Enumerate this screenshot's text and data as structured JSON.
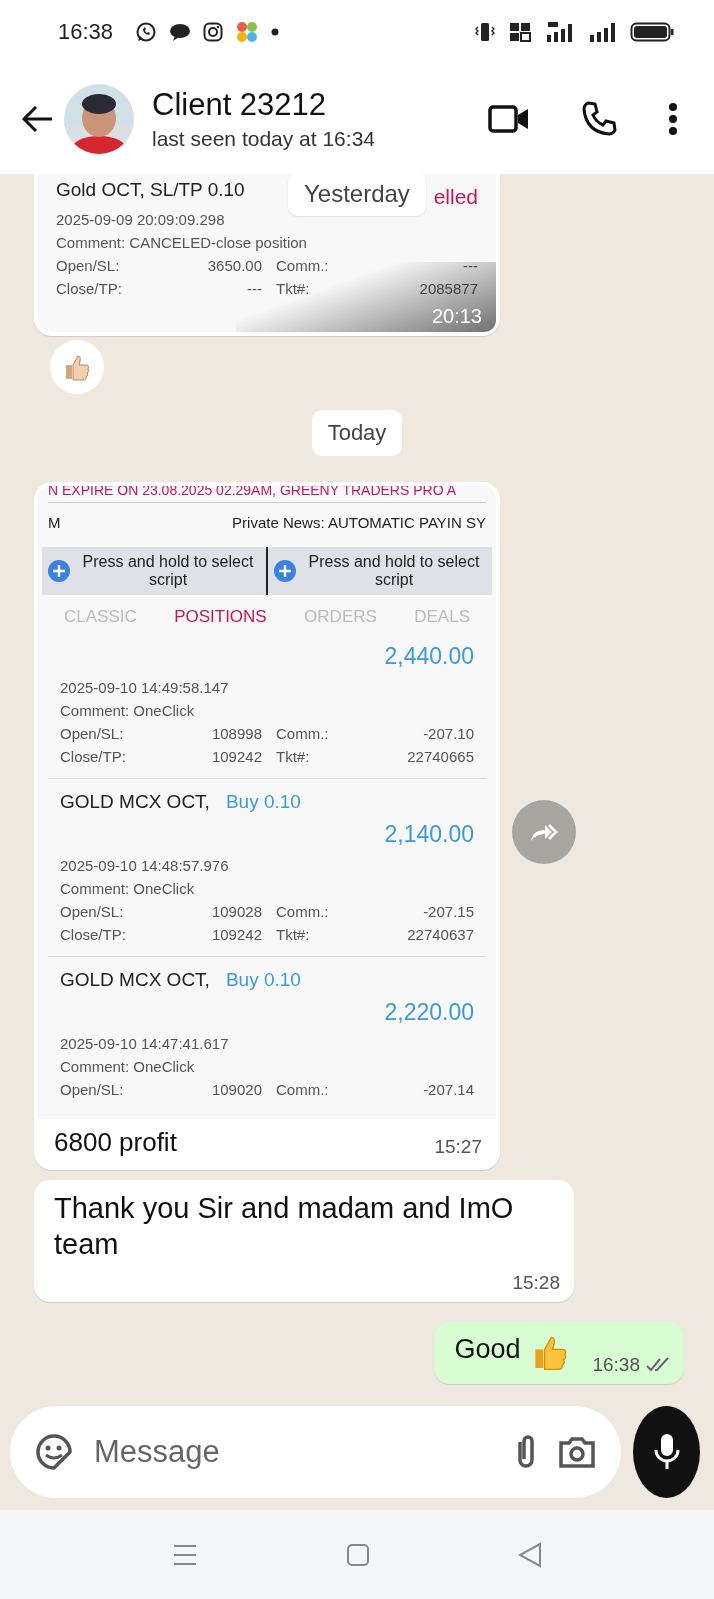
{
  "status_bar": {
    "time": "16:38"
  },
  "header": {
    "contact_name": "Client 23212",
    "last_seen": "last seen today at 16:34"
  },
  "messages": [
    {
      "kind": "trade_image",
      "date_overlay": "Yesterday",
      "time": "20:13",
      "reaction": true,
      "card": {
        "title": "Gold OCT,  SL/TP 0.10",
        "status": "elled",
        "datetime": "2025-09-09 20:09:09.298",
        "comment": "Comment: CANCELED-close position",
        "open_label": "Open/SL:",
        "open": "3650.00",
        "comm_label": "Comm.:",
        "comm": "---",
        "close_label": "Close/TP:",
        "close": "---",
        "ticket_label": "Tkt#:",
        "ticket": "2085877"
      }
    },
    {
      "kind": "date",
      "label": "Today"
    },
    {
      "kind": "terminal_image",
      "forward": true,
      "caption": "6800 profit",
      "time": "15:27",
      "terminal": {
        "ticker": "N  EXPIRE ON 23.08.2025 02.29AM, GREENY TRADERS PRO A",
        "news_left": "M",
        "news": "Private News:  AUTOMATIC PAYIN SY",
        "select_buttons": [
          "Press and hold to select script",
          "Press and hold to select script"
        ],
        "tabs": [
          {
            "label": "CLASSIC",
            "selected": false
          },
          {
            "label": "POSITIONS",
            "selected": true
          },
          {
            "label": "ORDERS",
            "selected": false
          },
          {
            "label": "DEALS",
            "selected": false
          }
        ],
        "positions": [
          {
            "profit": "2,440.00",
            "datetime": "2025-09-10 14:49:58.147",
            "comment": "Comment: OneClick",
            "rows": [
              [
                "Open/SL:",
                "108998",
                "Comm.:",
                "-207.10"
              ],
              [
                "Close/TP:",
                "109242",
                "Tkt#:",
                "22740665"
              ]
            ]
          },
          {
            "symbol": "GOLD MCX OCT,",
            "side": "Buy 0.10",
            "profit": "2,140.00",
            "datetime": "2025-09-10 14:48:57.976",
            "comment": "Comment: OneClick",
            "rows": [
              [
                "Open/SL:",
                "109028",
                "Comm.:",
                "-207.15"
              ],
              [
                "Close/TP:",
                "109242",
                "Tkt#:",
                "22740637"
              ]
            ]
          },
          {
            "symbol": "GOLD MCX OCT,",
            "side": "Buy 0.10",
            "profit": "2,220.00",
            "datetime": "2025-09-10 14:47:41.617",
            "comment": "Comment: OneClick",
            "rows": [
              [
                "Open/SL:",
                "109020",
                "Comm.:",
                "-207.14"
              ]
            ]
          }
        ]
      }
    },
    {
      "kind": "received",
      "text": "Thank you Sir and madam and ImO team",
      "time": "15:28"
    },
    {
      "kind": "sent",
      "text": "Good",
      "thumbs_up": true,
      "time": "16:38",
      "read": false
    }
  ],
  "composer": {
    "placeholder": "Message"
  }
}
